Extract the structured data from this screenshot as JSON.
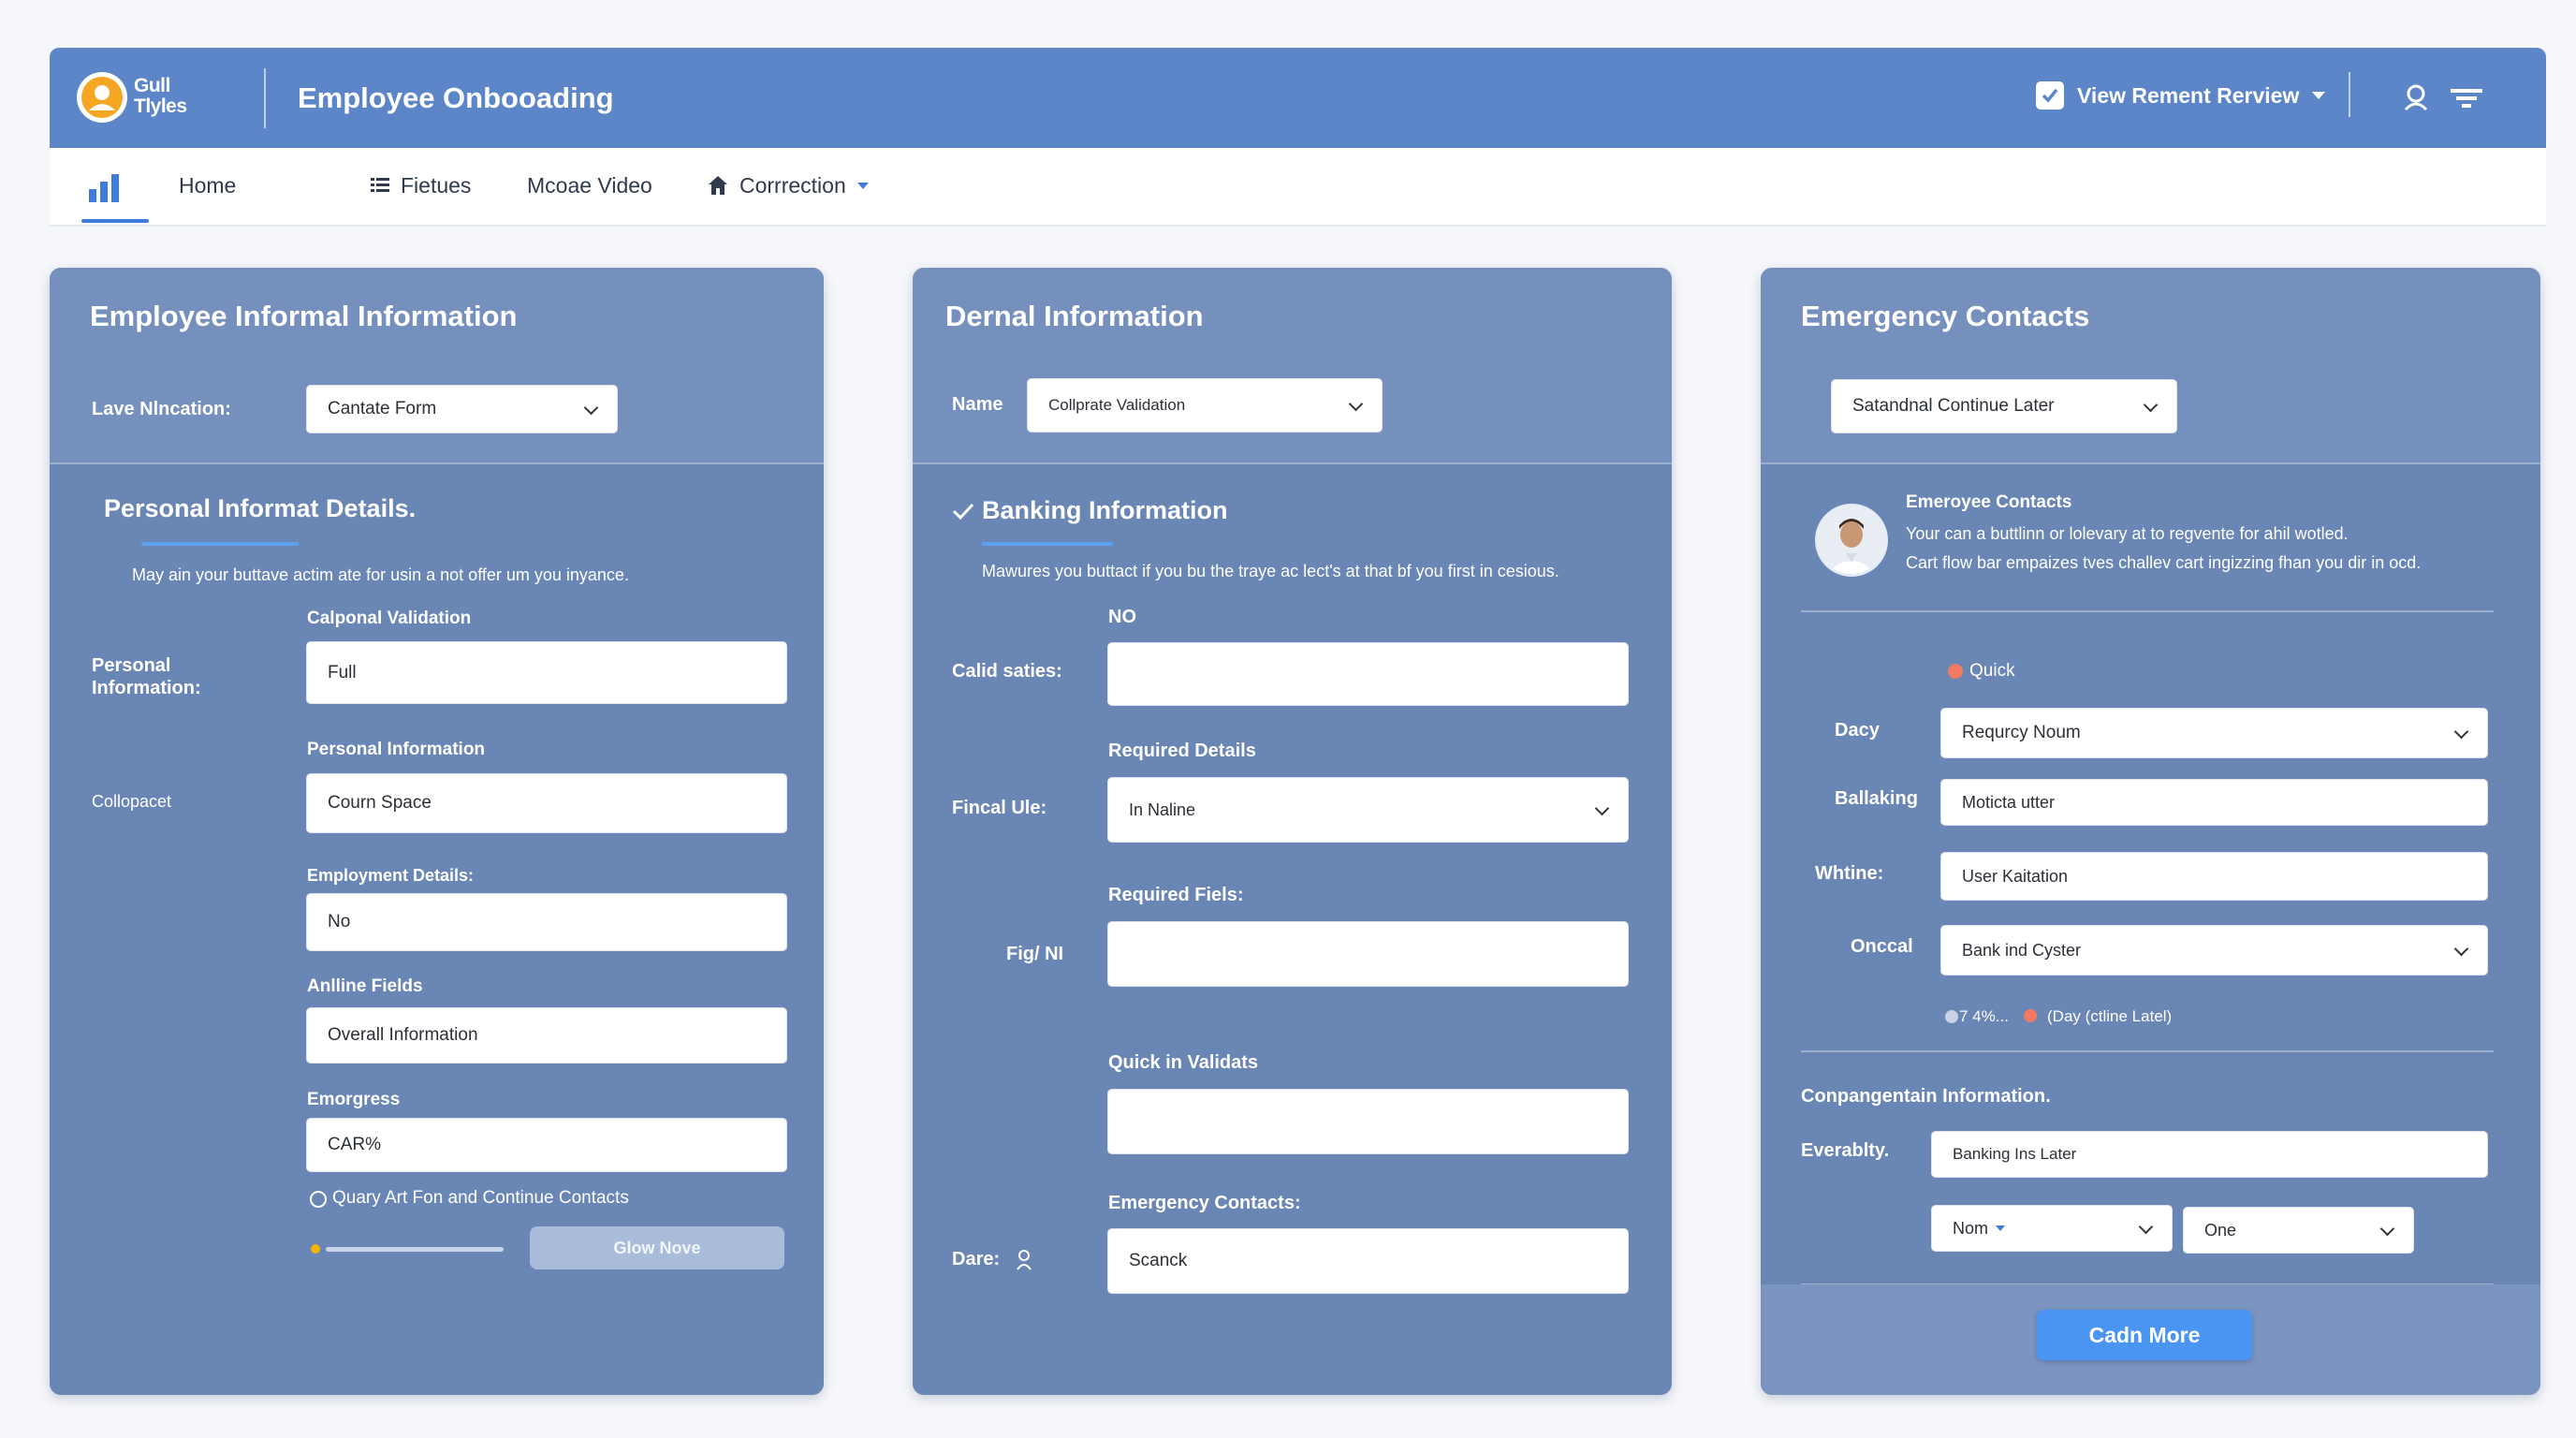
{
  "app": {
    "logo_line1": "Gull",
    "logo_line2": "Tlyles",
    "title": "Employee Onbooading",
    "view_menu_label": "View Rement Rerview"
  },
  "nav": {
    "items": [
      {
        "label": "Home"
      },
      {
        "label": "Fietues"
      },
      {
        "label": "Mcoae Video"
      },
      {
        "label": "Corrrection"
      }
    ]
  },
  "panel1": {
    "title": "Employee Informal Information",
    "location_label": "Lave Nlncation:",
    "location_value": "Cantate Form",
    "section_title": "Personal Informat Details.",
    "description": "May ain your buttave actim ate for usin a not offer um you inyance.",
    "group_label": "Personal Information:",
    "side_label": "Collopacet",
    "fields": [
      {
        "label": "Calponal Validation",
        "value": "Full"
      },
      {
        "label": "Personal Information",
        "value": "Courn Space"
      },
      {
        "label": "Employment Details:",
        "value": "No"
      },
      {
        "label": "Anlline Fields",
        "value": "Overall Information"
      },
      {
        "label": "Emorgress",
        "value": "CAR%"
      }
    ],
    "radio_label": "Quary Art Fon and Continue Contacts",
    "button_label": "Glow Nove",
    "progress": 0.05
  },
  "panel2": {
    "title": "Dernal Information",
    "name_label": "Name",
    "name_value": "Collprate Validation",
    "section_title": "Banking Information",
    "description": "Mawures you buttact if you bu the traye ac lect's at that bf you first in cesious.",
    "rows": [
      {
        "side_label": "Calid saties:",
        "label": "NO",
        "value": ""
      },
      {
        "side_label": "Fincal Ule:",
        "label": "Required Details",
        "value": "In Naline"
      },
      {
        "side_label": "Fig/ NI",
        "label": "Required Fiels:",
        "value": ""
      },
      {
        "side_label": "",
        "label": "Quick in Validats",
        "value": ""
      },
      {
        "side_label": "Dare:",
        "label": "Emergency Contacts:",
        "value": "Scanck"
      }
    ]
  },
  "panel3": {
    "title": "Emergency Contacts",
    "top_select": "Satandnal Continue Later",
    "contact_title": "Emeroyee Contacts",
    "contact_line1": "Your can a buttlinn or lolevary at to regvente for ahil wotled.",
    "contact_line2": "Cart flow bar empaizes tves challev cart ingizzing fhan you dir in ocd.",
    "quick_label": "Quick",
    "rows": [
      {
        "label": "Dacy",
        "value": "Requrcy Noum"
      },
      {
        "label": "Ballaking",
        "value": "Moticta utter"
      },
      {
        "label": "Whtine:",
        "value": "User Kaitation"
      },
      {
        "label": "Onccal",
        "value": "Bank ind Cyster"
      }
    ],
    "status_text": "7 4%...",
    "status_note": "(Day (ctline Latel)",
    "comp_title": "Conpangentain Information.",
    "everabilty_label": "Everablty.",
    "everabilty_value": "Banking Ins Later",
    "select_a": "Nom",
    "select_b": "One",
    "button_label": "Cadn More"
  },
  "icons": {
    "logo": "user-badge-icon",
    "view_check": "checkbox-icon",
    "user": "user-icon",
    "filter": "filter-icon",
    "home_nav": "bar-chart-icon",
    "features_nav": "list-icon",
    "correction_nav": "house-icon",
    "banking_check": "checkmark-icon",
    "date_person": "person-icon"
  },
  "colors": {
    "header": "#5c86c7",
    "panel": "#6a86b4",
    "accent": "#4a94f2"
  }
}
